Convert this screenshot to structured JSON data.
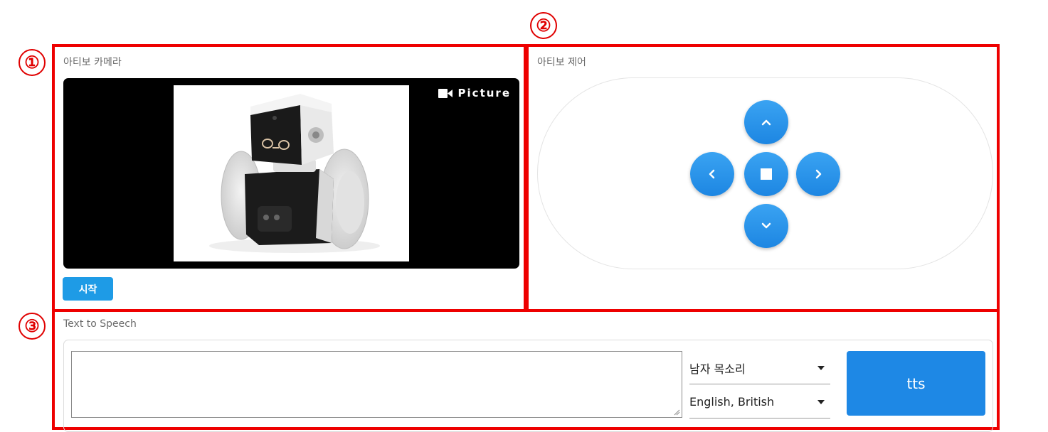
{
  "annotations": {
    "marker_1": "①",
    "marker_2": "②",
    "marker_3": "③"
  },
  "camera": {
    "section_label": "아티보 카메라",
    "picture_label": "Picture",
    "start_button": "시작"
  },
  "control": {
    "section_label": "아티보 제어",
    "buttons": [
      "up",
      "left",
      "stop",
      "right",
      "down"
    ]
  },
  "tts": {
    "section_label": "Text to Speech",
    "text_value": "",
    "voice_selected": "남자 목소리",
    "language_selected": "English, British",
    "submit_label": "tts"
  },
  "colors": {
    "annotation_red": "#ee0000",
    "button_blue": "#1e88e5",
    "start_blue": "#1e9be6"
  }
}
